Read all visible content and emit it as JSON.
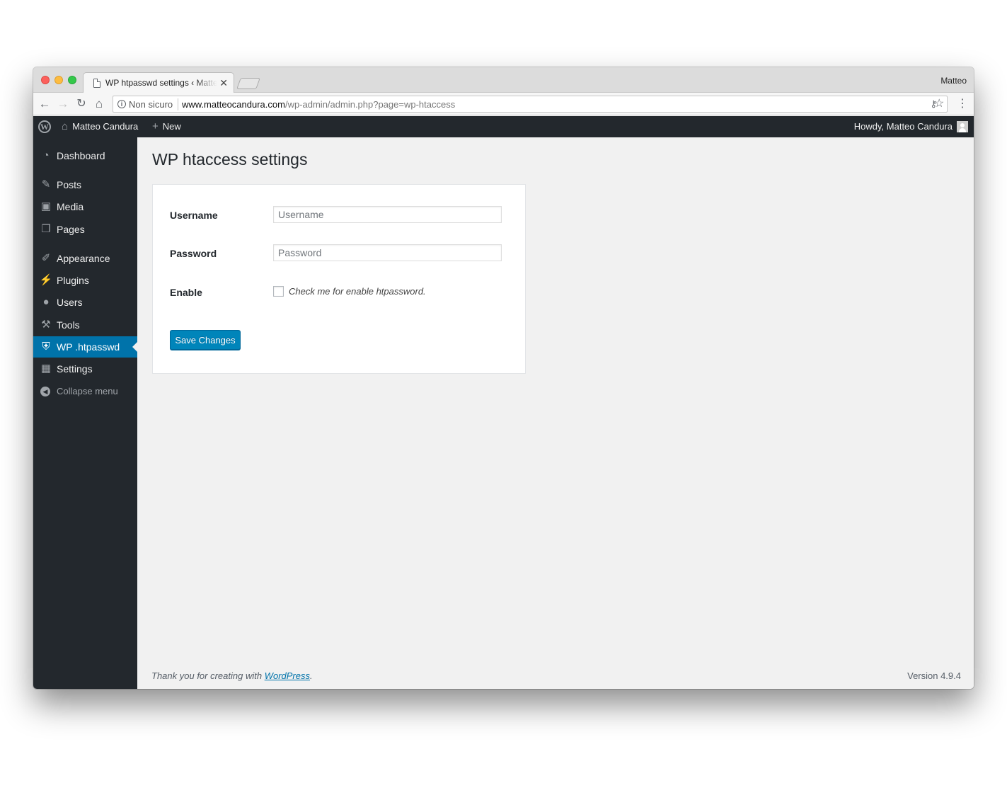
{
  "browser": {
    "tab_title": "WP htpasswd settings ‹ Matteo Candura",
    "profile_name": "Matteo",
    "security_label": "Non sicuro",
    "url_host": "www.matteocandura.com",
    "url_path": "/wp-admin/admin.php?page=wp-htaccess"
  },
  "adminbar": {
    "site_name": "Matteo Candura",
    "new_label": "New",
    "howdy": "Howdy, Matteo Candura"
  },
  "sidebar": {
    "items": [
      {
        "label": "Dashboard",
        "icon": "dashboard-icon"
      },
      {
        "label": "Posts",
        "icon": "pin-icon"
      },
      {
        "label": "Media",
        "icon": "media-icon"
      },
      {
        "label": "Pages",
        "icon": "pages-icon"
      },
      {
        "label": "Appearance",
        "icon": "brush-icon"
      },
      {
        "label": "Plugins",
        "icon": "plug-icon"
      },
      {
        "label": "Users",
        "icon": "user-icon"
      },
      {
        "label": "Tools",
        "icon": "wrench-icon"
      },
      {
        "label": "WP .htpasswd",
        "icon": "shield-icon",
        "current": true
      },
      {
        "label": "Settings",
        "icon": "settings-icon"
      }
    ],
    "collapse_label": "Collapse menu"
  },
  "page": {
    "title": "WP htaccess settings",
    "username_label": "Username",
    "username_placeholder": "Username",
    "username_value": "",
    "password_label": "Password",
    "password_placeholder": "Password",
    "password_value": "",
    "enable_label": "Enable",
    "enable_checked": false,
    "enable_description": "Check me for enable htpassword.",
    "save_label": "Save Changes"
  },
  "footer": {
    "thanks_prefix": "Thank you for creating with ",
    "thanks_link": "WordPress",
    "thanks_suffix": ".",
    "version": "Version 4.9.4"
  },
  "colors": {
    "admin_dark": "#23282d",
    "accent_blue": "#0073aa",
    "button_blue": "#0085ba"
  }
}
